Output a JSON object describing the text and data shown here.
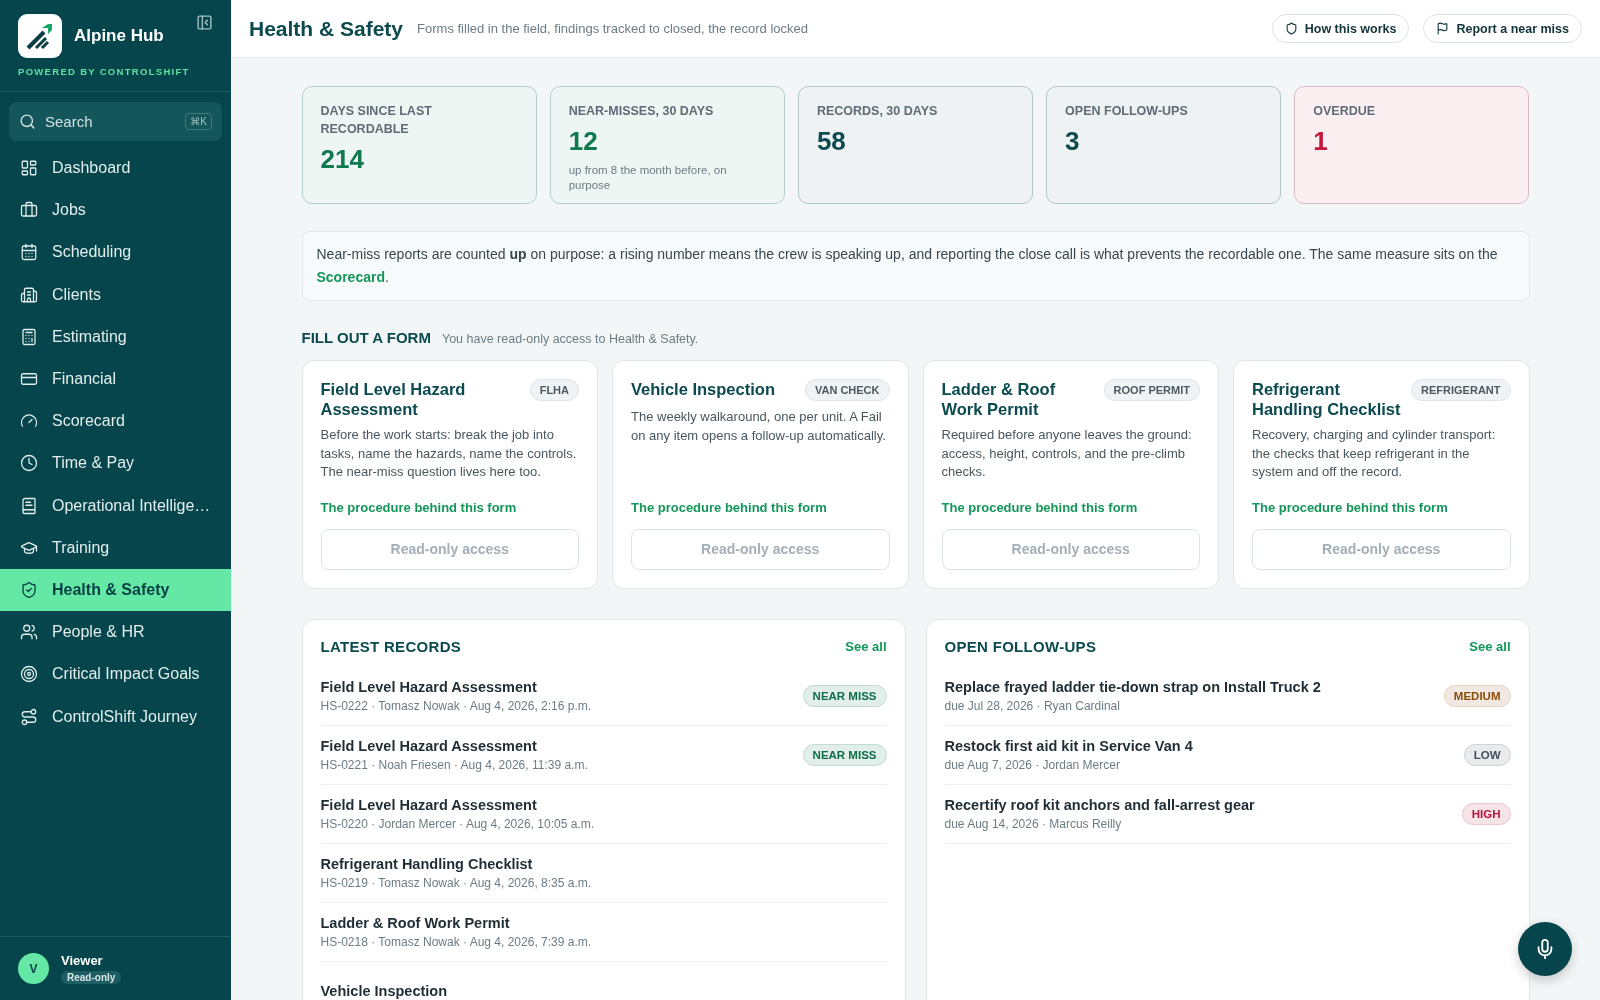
{
  "brand": {
    "name": "Alpine Hub",
    "tagline": "POWERED BY CONTROLSHIFT"
  },
  "search": {
    "placeholder": "Search",
    "shortcut": "⌘K"
  },
  "nav": [
    {
      "label": "Dashboard",
      "selected": false
    },
    {
      "label": "Jobs",
      "selected": false
    },
    {
      "label": "Scheduling",
      "selected": false
    },
    {
      "label": "Clients",
      "selected": false
    },
    {
      "label": "Estimating",
      "selected": false
    },
    {
      "label": "Financial",
      "selected": false
    },
    {
      "label": "Scorecard",
      "selected": false
    },
    {
      "label": "Time & Pay",
      "selected": false
    },
    {
      "label": "Operational Intellige…",
      "selected": false
    },
    {
      "label": "Training",
      "selected": false
    },
    {
      "label": "Health & Safety",
      "selected": true
    },
    {
      "label": "People & HR",
      "selected": false
    },
    {
      "label": "Critical Impact Goals",
      "selected": false
    },
    {
      "label": "ControlShift Journey",
      "selected": false
    }
  ],
  "user": {
    "initial": "V",
    "name": "Viewer",
    "role": "Read-only"
  },
  "header": {
    "title": "Health & Safety",
    "subtitle": "Forms filled in the field, findings tracked to closed, the record locked",
    "actions": [
      "How this works",
      "Report a near miss"
    ]
  },
  "stats": [
    {
      "label": "DAYS SINCE LAST RECORDABLE",
      "value": "214",
      "color": "#0f7a4f"
    },
    {
      "label": "NEAR-MISSES, 30 DAYS",
      "value": "12",
      "note": "up from 8 the month before, on purpose",
      "color": "#0f7a4f"
    },
    {
      "label": "RECORDS, 30 DAYS",
      "value": "58",
      "color": "#0d4a4f"
    },
    {
      "label": "OPEN FOLLOW-UPS",
      "value": "3",
      "color": "#0d4a4f"
    },
    {
      "label": "OVERDUE",
      "value": "1",
      "color": "#c4173d"
    }
  ],
  "notice": {
    "text": "Near-miss reports are counted **up** on purpose: a rising number means the crew is speaking up, and reporting the close call is what prevents the recordable one. The same measure sits on the",
    "link": "Scorecard",
    "end": "."
  },
  "forms_section": {
    "title": "FILL OUT A FORM",
    "note": "You have read-only access to Health & Safety."
  },
  "forms": [
    {
      "title": "Field Level Hazard Assessment",
      "tag": "FLHA",
      "text": "Before the work starts: break the job into tasks, name the hazards, name the controls. The near-miss question lives here too.",
      "link": "The procedure behind this form",
      "button": "Read-only access",
      "disabled": true
    },
    {
      "title": "Vehicle Inspection",
      "tag": "VAN CHECK",
      "text": "The weekly walkaround, one per unit. A Fail on any item opens a follow-up automatically.",
      "link": "The procedure behind this form",
      "button": "Read-only access",
      "disabled": true
    },
    {
      "title": "Ladder & Roof Work Permit",
      "tag": "ROOF PERMIT",
      "text": "Required before anyone leaves the ground: access, height, controls, and the pre-climb checks.",
      "link": "The procedure behind this form",
      "button": "Read-only access",
      "disabled": true
    },
    {
      "title": "Refrigerant Handling Checklist",
      "tag": "REFRIGERANT",
      "text": "Recovery, charging and cylinder transport: the checks that keep refrigerant in the system and off the record.",
      "link": "The procedure behind this form",
      "button": "Read-only access",
      "disabled": true
    }
  ],
  "latest_records": {
    "title": "LATEST RECORDS",
    "link": "See all",
    "rows": [
      {
        "title": "Field Level Hazard Assessment",
        "meta": "HS-0222 · Tomasz Nowak · Aug 4, 2026, 2:16 p.m.",
        "badge": "NEAR MISS",
        "color": "#0f6e47"
      },
      {
        "title": "Field Level Hazard Assessment",
        "meta": "HS-0221 · Noah Friesen · Aug 4, 2026, 11:39 a.m.",
        "badge": "NEAR MISS",
        "color": "#0f6e47"
      },
      {
        "title": "Field Level Hazard Assessment",
        "meta": "HS-0220 · Jordan Mercer · Aug 4, 2026, 10:05 a.m."
      },
      {
        "title": "Refrigerant Handling Checklist",
        "meta": "HS-0219 · Tomasz Nowak · Aug 4, 2026, 8:35 a.m."
      },
      {
        "title": "Ladder & Roof Work Permit",
        "meta": "HS-0218 · Tomasz Nowak · Aug 4, 2026, 7:39 a.m."
      },
      {
        "title": "Vehicle Inspection"
      }
    ]
  },
  "open_follow_ups": {
    "title": "OPEN FOLLOW-UPS",
    "link": "See all",
    "rows": [
      {
        "title": "Replace frayed ladder tie-down strap on Install Truck 2",
        "meta": "due Jul 28, 2026 · Ryan Cardinal",
        "badge": "MEDIUM",
        "color": "#8a4b06"
      },
      {
        "title": "Restock first aid kit in Service Van 4",
        "meta": "due Aug 7, 2026 · Jordan Mercer",
        "badge": "LOW",
        "color": "#3f4f5a"
      },
      {
        "title": "Recertify roof kit anchors and fall-arrest gear",
        "meta": "due Aug 14, 2026 · Marcus Reilly",
        "badge": "HIGH",
        "color": "#b3163c"
      }
    ]
  }
}
